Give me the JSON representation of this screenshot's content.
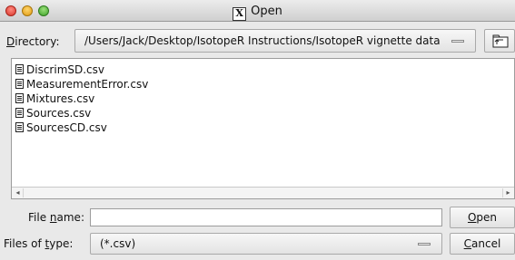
{
  "window": {
    "title": "Open",
    "app_icon": "x11-icon"
  },
  "directory": {
    "label_mnemonic": "D",
    "label_rest": "irectory:",
    "path": "/Users/Jack/Desktop/IsotopeR Instructions/IsotopeR vignette data",
    "up_button_icon": "up-folder-icon"
  },
  "files": [
    {
      "name": "DiscrimSD.csv",
      "icon": "file-icon"
    },
    {
      "name": "MeasurementError.csv",
      "icon": "file-icon"
    },
    {
      "name": "Mixtures.csv",
      "icon": "file-icon"
    },
    {
      "name": "Sources.csv",
      "icon": "file-icon"
    },
    {
      "name": "SourcesCD.csv",
      "icon": "file-icon"
    }
  ],
  "filename": {
    "label_pre": "File ",
    "label_mnemonic": "n",
    "label_post": "ame:",
    "value": ""
  },
  "filetype": {
    "label_pre": "Files of ",
    "label_mnemonic": "t",
    "label_post": "ype:",
    "selected": "(*.csv)"
  },
  "buttons": {
    "open_mnemonic": "O",
    "open_rest": "pen",
    "cancel_mnemonic": "C",
    "cancel_rest": "ancel"
  },
  "colors": {
    "close": "#d8362a",
    "minimize": "#e09a12",
    "maximize": "#3ea22a"
  }
}
